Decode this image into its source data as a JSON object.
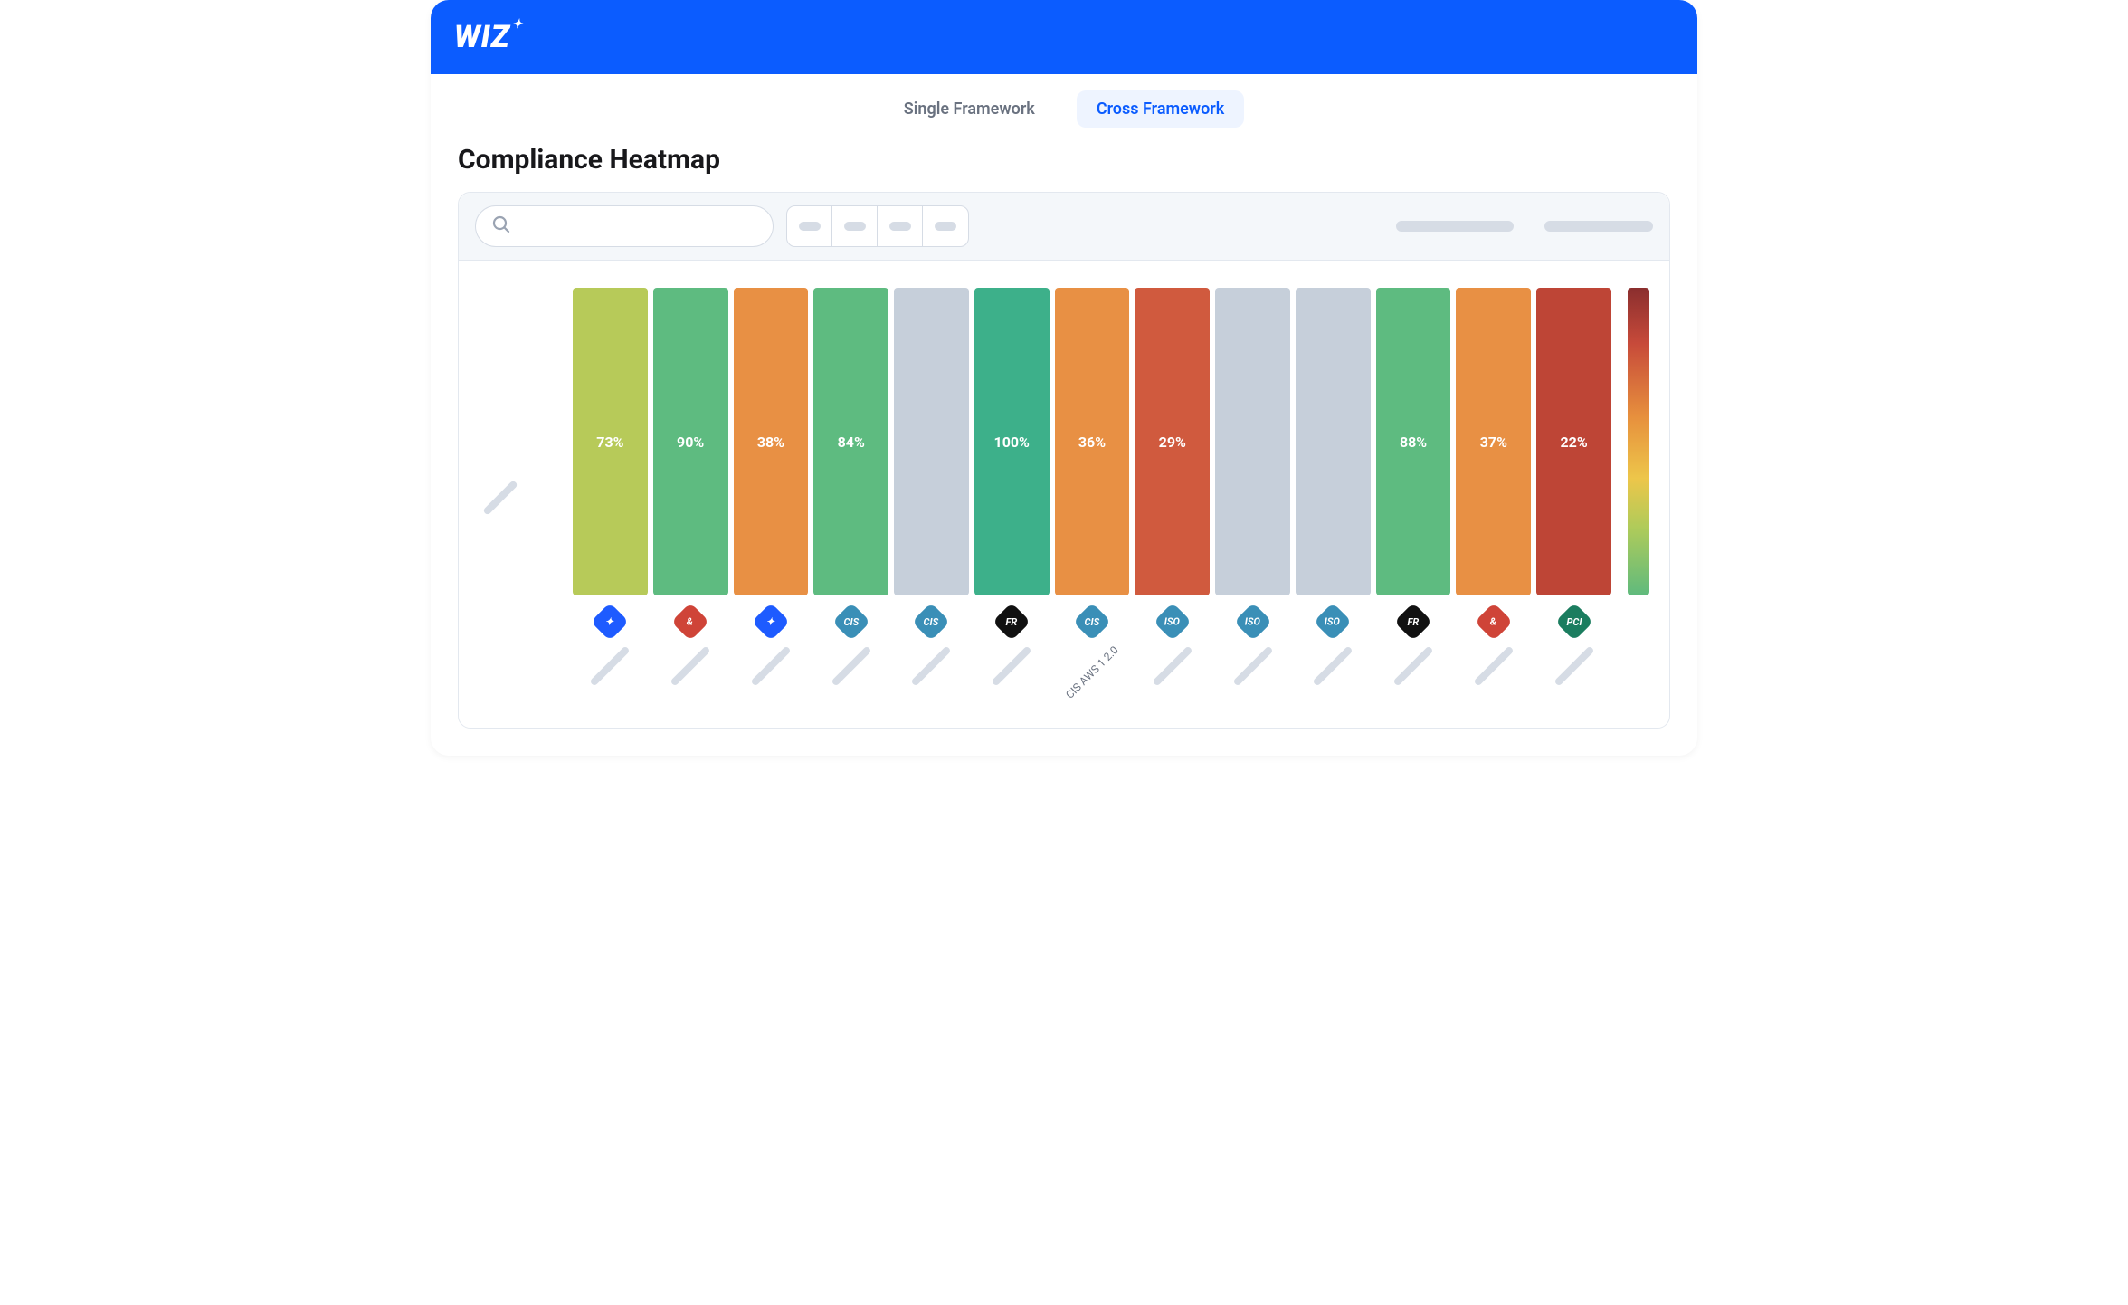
{
  "brand": "WIZ",
  "tabs": {
    "single": "Single Framework",
    "cross": "Cross Framework",
    "active": "cross"
  },
  "page_title": "Compliance Heatmap",
  "search": {
    "placeholder": ""
  },
  "chart_data": {
    "type": "heatmap",
    "title": "Compliance Heatmap",
    "ylabel": "",
    "xlabel": "",
    "legend": {
      "orientation": "vertical",
      "scale": [
        "low",
        "high"
      ],
      "colors_top_to_bottom": [
        "#8A2E2E",
        "#C74A3A",
        "#E7903D",
        "#EDC64A",
        "#AFCB5A",
        "#5FBA7D"
      ]
    },
    "rows": [
      ""
    ],
    "columns": [
      {
        "id": "f0",
        "label": "",
        "icon": "star",
        "icon_bg": "#1E5BFF",
        "value": 73,
        "value_label": "73%",
        "color": "#B7CA59"
      },
      {
        "id": "f1",
        "label": "",
        "icon": "ampersand",
        "icon_bg": "#CF4438",
        "value": 90,
        "value_label": "90%",
        "color": "#5EBB80"
      },
      {
        "id": "f2",
        "label": "",
        "icon": "star",
        "icon_bg": "#1E5BFF",
        "value": 38,
        "value_label": "38%",
        "color": "#E89044"
      },
      {
        "id": "f3",
        "label": "",
        "icon": "cis",
        "icon_bg": "#3A8FB7",
        "value": 84,
        "value_label": "84%",
        "color": "#5EBB80"
      },
      {
        "id": "f4",
        "label": "",
        "icon": "cis",
        "icon_bg": "#3A8FB7",
        "value": null,
        "value_label": "",
        "color": "#C6CFDA"
      },
      {
        "id": "f5",
        "label": "",
        "icon": "fr",
        "icon_bg": "#111111",
        "value": 100,
        "value_label": "100%",
        "color": "#3DB08A"
      },
      {
        "id": "f6",
        "label": "CIS AWS 1.2.0",
        "icon": "cis",
        "icon_bg": "#3A8FB7",
        "value": 36,
        "value_label": "36%",
        "color": "#E89044"
      },
      {
        "id": "f7",
        "label": "",
        "icon": "iso",
        "icon_bg": "#3A8FB7",
        "value": 29,
        "value_label": "29%",
        "color": "#D05A3E"
      },
      {
        "id": "f8",
        "label": "",
        "icon": "iso",
        "icon_bg": "#3A8FB7",
        "value": null,
        "value_label": "",
        "color": "#C6CFDA"
      },
      {
        "id": "f9",
        "label": "",
        "icon": "iso",
        "icon_bg": "#3A8FB7",
        "value": null,
        "value_label": "",
        "color": "#C6CFDA"
      },
      {
        "id": "f10",
        "label": "",
        "icon": "fr",
        "icon_bg": "#111111",
        "value": 88,
        "value_label": "88%",
        "color": "#5EBB80"
      },
      {
        "id": "f11",
        "label": "",
        "icon": "ampersand",
        "icon_bg": "#CF4438",
        "value": 37,
        "value_label": "37%",
        "color": "#E89044"
      },
      {
        "id": "f12",
        "label": "",
        "icon": "pci",
        "icon_bg": "#1B7D5F",
        "value": 22,
        "value_label": "22%",
        "color": "#BE4536"
      }
    ]
  }
}
